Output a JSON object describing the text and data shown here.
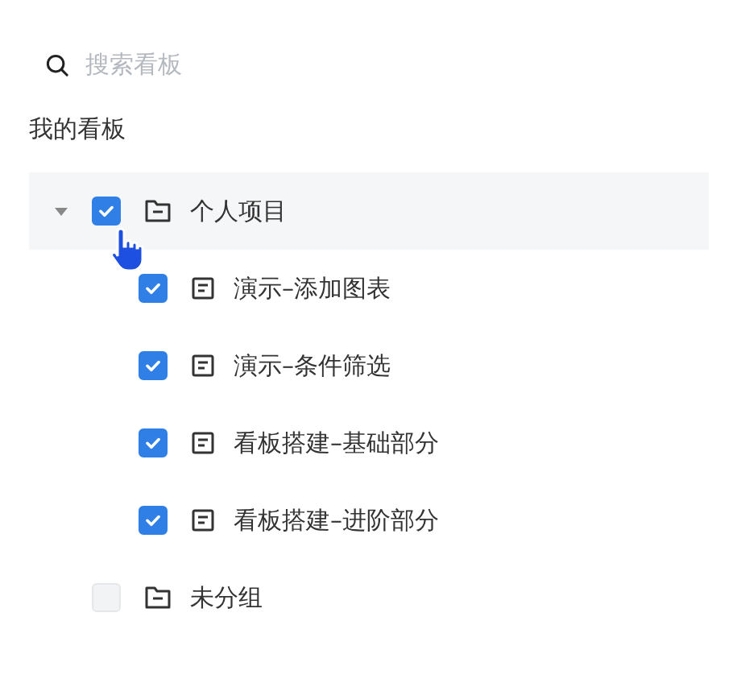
{
  "search": {
    "placeholder": "搜索看板"
  },
  "section_title": "我的看板",
  "tree": [
    {
      "kind": "folder",
      "label": "个人项目",
      "checked": true,
      "expanded": true,
      "hovered": true,
      "children": [
        {
          "kind": "board",
          "label": "演示–添加图表",
          "checked": true,
          "hovered": false
        },
        {
          "kind": "board",
          "label": "演示–条件筛选",
          "checked": true,
          "hovered": false
        },
        {
          "kind": "board",
          "label": "看板搭建–基础部分",
          "checked": true,
          "hovered": false
        },
        {
          "kind": "board",
          "label": "看板搭建–进阶部分",
          "checked": true,
          "hovered": false
        }
      ]
    },
    {
      "kind": "folder",
      "label": "未分组",
      "checked": false,
      "hovered": false
    }
  ]
}
